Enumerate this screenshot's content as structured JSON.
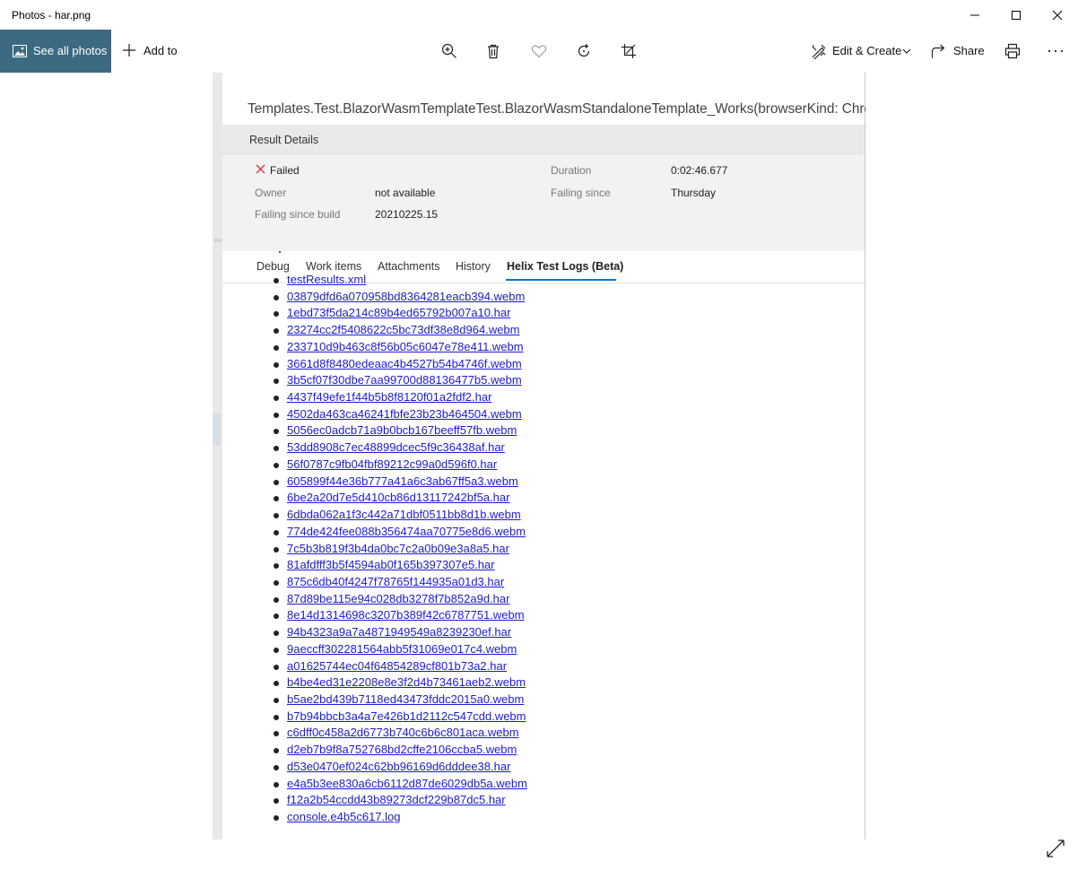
{
  "window": {
    "title": "Photos - har.png"
  },
  "toolbar": {
    "see_all": "See all photos",
    "add_to": "Add to",
    "edit_create": "Edit & Create",
    "share": "Share"
  },
  "screenshot": {
    "test_title": "Templates.Test.BlazorWasmTemplateTest.BlazorWasmStandaloneTemplate_Works(browserKind: Chromiu",
    "result_details": {
      "header": "Result Details",
      "status": "Failed",
      "duration_label": "Duration",
      "duration_value": "0:02:46.677",
      "owner_label": "Owner",
      "owner_value": "not available",
      "failing_since_label": "Failing since",
      "failing_since_value": "Thursday",
      "failing_build_label": "Failing since build",
      "failing_build_value": "20210225.15"
    },
    "tabs": [
      "Debug",
      "Work items",
      "Attachments",
      "History",
      "Helix Test Logs (Beta)"
    ],
    "files": [
      "testResults.xml",
      "03879dfd6a070958bd8364281eacb394.webm",
      "1ebd73f5da214c89b4ed65792b007a10.har",
      "23274cc2f5408622c5bc73df38e8d964.webm",
      "233710d9b463c8f56b05c6047e78e411.webm",
      "3661d8f8480edeaac4b4527b54b4746f.webm",
      "3b5cf07f30dbe7aa99700d88136477b5.webm",
      "4437f49efe1f44b5b8f8120f01a2fdf2.har",
      "4502da463ca46241fbfe23b23b464504.webm",
      "5056ec0adcb71a9b0bcb167beeff57fb.webm",
      "53dd8908c7ec48899dcec5f9c36438af.har",
      "56f0787c9fb04fbf89212c99a0d596f0.har",
      "605899f44e36b777a41a6c3ab67ff5a3.webm",
      "6be2a20d7e5d410cb86d13117242bf5a.har",
      "6dbda062a1f3c442a71dbf0511bb8d1b.webm",
      "774de424fee088b356474aa70775e8d6.webm",
      "7c5b3b819f3b4da0bc7c2a0b09e3a8a5.har",
      "81afdfff3b5f4594ab0f165b397307e5.har",
      "875c6db40f4247f78765f144935a01d3.har",
      "87d89be115e94c028db3278f7b852a9d.har",
      "8e14d1314698c3207b389f42c6787751.webm",
      "94b4323a9a7a4871949549a8239230ef.har",
      "9aeccff302281564abb5f31069e017c4.webm",
      "a01625744ec04f64854289cf801b73a2.har",
      "b4be4ed31e2208e8e3f2d4b73461aeb2.webm",
      "b5ae2bd439b7118ed43473fddc2015a0.webm",
      "b7b94bbcb3a4a7e426b1d2112c547cdd.webm",
      "c6dff0c458a2d6773b740c6b6c801aca.webm",
      "d2eb7b9f8a752768bd2cffe2106ccba5.webm",
      "d53e0470ef024c62bb96169d6dddee38.har",
      "e4a5b3ee830a6cb6112d87de6029db5a.webm",
      "f12a2b54ccdd43b89273dcf229b87dc5.har",
      "console.e4b5c617.log"
    ]
  },
  "colors": {
    "accent": "#3c6a80",
    "link": "#1b1bd6",
    "failed": "#d13438",
    "tab_underline": "#0078d4"
  },
  "icons": [
    "image-icon",
    "plus-icon",
    "zoom-in-icon",
    "delete-icon",
    "heart-icon",
    "rotate-icon",
    "crop-icon",
    "edit-create-icon",
    "chevron-down-icon",
    "share-icon",
    "print-icon",
    "more-icon",
    "minimize-icon",
    "maximize-icon",
    "close-icon",
    "fail-x-icon",
    "expand-icon"
  ]
}
